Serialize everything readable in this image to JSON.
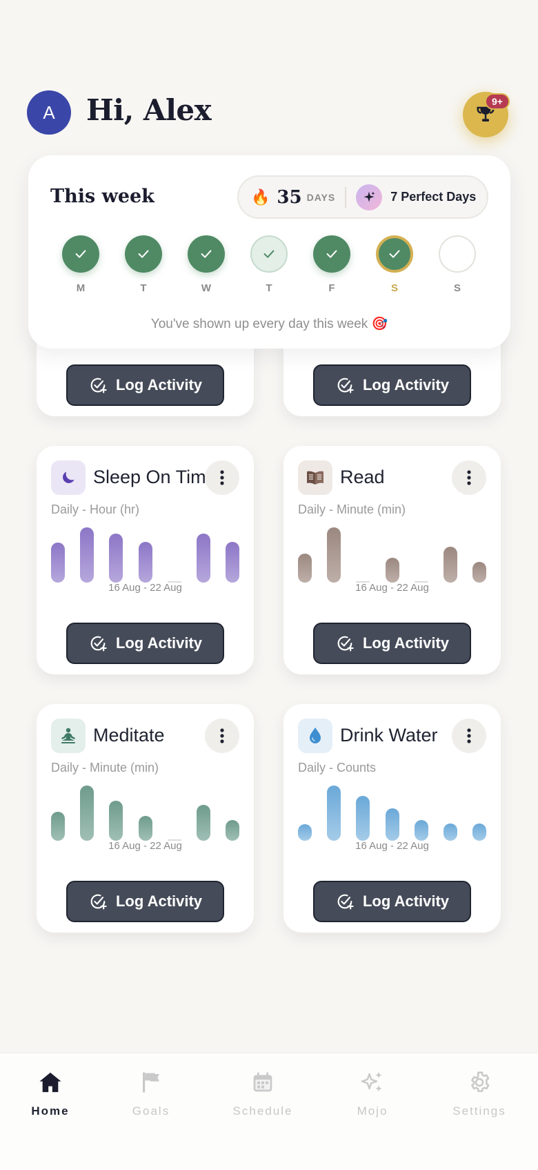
{
  "header": {
    "avatar_letter": "A",
    "greeting": "Hi, Alex",
    "trophy_badge": "9+"
  },
  "week": {
    "title": "This week",
    "streak_count": "35",
    "streak_unit": "DAYS",
    "perfect_days": "7 Perfect Days",
    "days": [
      {
        "label": "M",
        "state": "done"
      },
      {
        "label": "T",
        "state": "done"
      },
      {
        "label": "W",
        "state": "done"
      },
      {
        "label": "T",
        "state": "light"
      },
      {
        "label": "F",
        "state": "done"
      },
      {
        "label": "S",
        "state": "today"
      },
      {
        "label": "S",
        "state": "empty"
      }
    ],
    "message": "You've shown up every day this week 🎯"
  },
  "log_label": "Log Activity",
  "cards": [
    {
      "title": "Sleep On Time",
      "subtitle": "Daily - Hour (hr)",
      "range": "16 Aug - 22 Aug",
      "icon": "moon-icon",
      "color": "#9b87cf",
      "color_top": "#8c76c7",
      "icon_bg": "#ebe6f6",
      "values": [
        0.73,
        1.0,
        0.89,
        0.74,
        0,
        0.89,
        0.74
      ]
    },
    {
      "title": "Read",
      "subtitle": "Daily - Minute (min)",
      "range": "16 Aug - 22 Aug",
      "icon": "book-icon",
      "color": "#a69289",
      "color_top": "#9b8880",
      "icon_bg": "#efe9e6",
      "values": [
        0.52,
        1.0,
        0,
        0.45,
        0,
        0.65,
        0.37
      ]
    },
    {
      "title": "Meditate",
      "subtitle": "Daily - Minute (min)",
      "range": "16 Aug - 22 Aug",
      "icon": "meditate-icon",
      "color": "#7ea89b",
      "color_top": "#6e9b8c",
      "icon_bg": "#e4eeea",
      "values": [
        0.52,
        1.0,
        0.73,
        0.45,
        0,
        0.65,
        0.37
      ]
    },
    {
      "title": "Drink Water",
      "subtitle": "Daily - Counts",
      "range": "16 Aug - 22 Aug",
      "icon": "water-drop-icon",
      "color": "#84b9e0",
      "color_top": "#6aa8d8",
      "icon_bg": "#e5eff8",
      "values": [
        0.3,
        1.0,
        0.81,
        0.59,
        0.38,
        0.31,
        0.31
      ]
    }
  ],
  "nav": [
    {
      "label": "Home",
      "icon": "home-icon",
      "active": true
    },
    {
      "label": "Goals",
      "icon": "flag-icon",
      "active": false
    },
    {
      "label": "Schedule",
      "icon": "calendar-icon",
      "active": false
    },
    {
      "label": "Mojo",
      "icon": "sparkles-icon",
      "active": false
    },
    {
      "label": "Settings",
      "icon": "gear-icon",
      "active": false
    }
  ]
}
